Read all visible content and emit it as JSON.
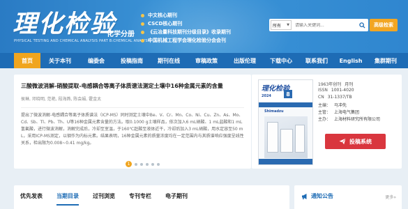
{
  "header": {
    "logo_text": "理化检验",
    "logo_subtitle": "化学分册",
    "logo_english": "PHYSICAL TESTING AND CHEMICAL ANALYSIS PART B:CHEMICAL ANALYSIS",
    "indexes": [
      "中文核心期刊",
      "CSCD核心期刊",
      "《云冶量科技期刊分级目录》收录期刊",
      "中国机械工程学会理化检验分会会刊"
    ],
    "search": {
      "scope": "所有",
      "placeholder": "请输入关键词...",
      "advanced_label": "高级检索"
    }
  },
  "nav": {
    "items": [
      "首页",
      "关于本刊",
      "编委会",
      "投稿指南",
      "期刊在线",
      "审稿政策",
      "出版伦理",
      "下载中心",
      "联系我们",
      "English",
      "集群期刊"
    ],
    "active": "首页"
  },
  "featured": {
    "title": "三酸微波消解-硝酸提取-电感耦合等离子体质谱法测定土壤中16种金属元素的含量",
    "authors": "侯琳, 邓晓明, 范艳, 段海燕, 陈会娟, 霍金太",
    "abstract": "提出了微波消解-电感耦合等离子体质谱法（ICP-MS）同时测定土壤中Be、V、Cr、Mn、Co、Ni、Cu、Zn、As、Mo、Cd、Sb、Tl、Pb、Th、U等16种金属元素含量的方法。取0.1000 g土壤样品，依次加入6 mL硝酸、1 mL盐酸和1 mL氢氟酸，进行微波消解，消解完成后，冷却至室温，于160℃赶酸至液体近干，冷却后加入3 mL硝酸，用水定容至50 mL，采用ICP-MS测定，以铟作为内标元素。结果表明，16种金属元素的质量浓度均在一定范围内与其质谱响应强度呈线性关系，检出限为0.008~0.41 mg/kg。",
    "active_page": "1",
    "page_count": 6
  },
  "journal": {
    "cover_title": "理化检验",
    "cover_subtitle": "化学分册",
    "cover_year": "2024",
    "cover_issue": "8",
    "cover_brand": "Shimadzu",
    "info": [
      {
        "k": "1963年创刊",
        "v": "月刊"
      },
      {
        "k": "ISSN",
        "v": "1001-4020"
      },
      {
        "k": "CN",
        "v": "31-1337/TB"
      },
      {
        "k": "主编：",
        "v": "马冲先"
      },
      {
        "k": "主管：",
        "v": "上海电气集团"
      },
      {
        "k": "主办：",
        "v": "上海材料研究所有限公司"
      }
    ],
    "submit_label": "投稿系统"
  },
  "tabs": {
    "items": [
      "优先发表",
      "当期目录",
      "过刊浏览",
      "专刊专栏",
      "电子期刊"
    ],
    "active": "当期目录"
  },
  "notice": {
    "title": "通知公告",
    "more": "更多»"
  },
  "colors": {
    "header_blue": "#2f86cf",
    "nav_blue": "#1e6cb5",
    "accent_orange": "#f0a51f",
    "submit_red": "#d9363e"
  }
}
